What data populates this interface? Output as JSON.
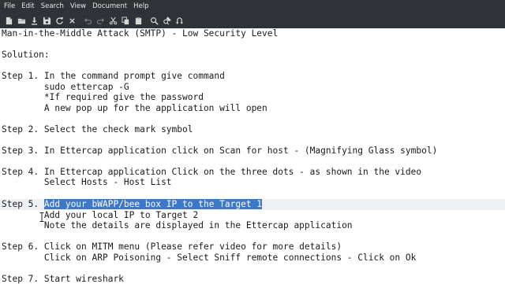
{
  "menu": [
    {
      "label": "File"
    },
    {
      "label": "Edit"
    },
    {
      "label": "Search"
    },
    {
      "label": "View"
    },
    {
      "label": "Document"
    },
    {
      "label": "Help"
    }
  ],
  "toolbar_icons": [
    "new-file-icon",
    "open-file-icon",
    "download-icon",
    "save-icon",
    "reload-icon",
    "close-icon",
    "undo-icon",
    "redo-icon",
    "cut-icon",
    "copy-icon",
    "paste-icon",
    "find-icon",
    "find-replace-icon",
    "goto-icon"
  ],
  "document": {
    "lines": [
      "Man-in-the-Middle Attack (SMTP) - Low Security Level",
      "",
      "Solution:",
      "",
      "Step 1. In the command prompt give command",
      "        sudo ettercap -G",
      "        *If required give the password",
      "        A new pop up for the application will open",
      "",
      "Step 2. Select the check mark symbol",
      "",
      "Step 3. In Ettercap application click on Scan for host - (Magnifying Glass symbol)",
      "",
      "Step 4. In Ettercap application Click on the three dots - as shown in the video",
      "        Select Hosts - Host List",
      "",
      "Step 5. ",
      "        Add your local IP to Target 2",
      "        Note the details are displayed in the Ettercap application",
      "",
      "Step 6. Click on MITM menu (Please refer video for more details)",
      "        Click on ARP Poisoning - Select Sniff remote connections - Click on Ok",
      "",
      "Step 7. Start wireshark"
    ],
    "selected_text": "Add your bWAPP/bee box IP to the Target 1"
  },
  "colors": {
    "chrome_bg": "#2f3237",
    "selection": "#3d77c8",
    "current_line": "#eef0f3"
  }
}
